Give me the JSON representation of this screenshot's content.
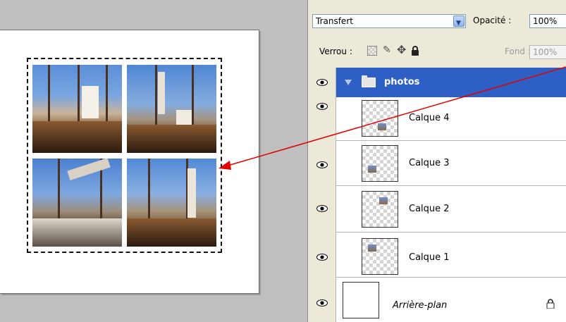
{
  "layers_panel": {
    "blend_mode": "Transfert",
    "opacity_label": "Opacité :",
    "opacity_value": "100%",
    "lock_label": "Verrou :",
    "fill_label": "Fond :",
    "fill_value": "100%",
    "group": {
      "name": "photos",
      "icon": "folder-icon",
      "expanded": true
    },
    "layers": [
      {
        "name": "Calque 4",
        "icon": "eye-icon"
      },
      {
        "name": "Calque 3",
        "icon": "eye-icon"
      },
      {
        "name": "Calque 2",
        "icon": "eye-icon"
      },
      {
        "name": "Calque 1",
        "icon": "eye-icon"
      }
    ],
    "background_layer": {
      "name": "Arrière-plan",
      "icon": "lock-icon"
    }
  },
  "colors": {
    "selection_highlight": "#2e5fc4",
    "annotation_arrow": "#e00000",
    "panel_background": "#ece9d8"
  }
}
